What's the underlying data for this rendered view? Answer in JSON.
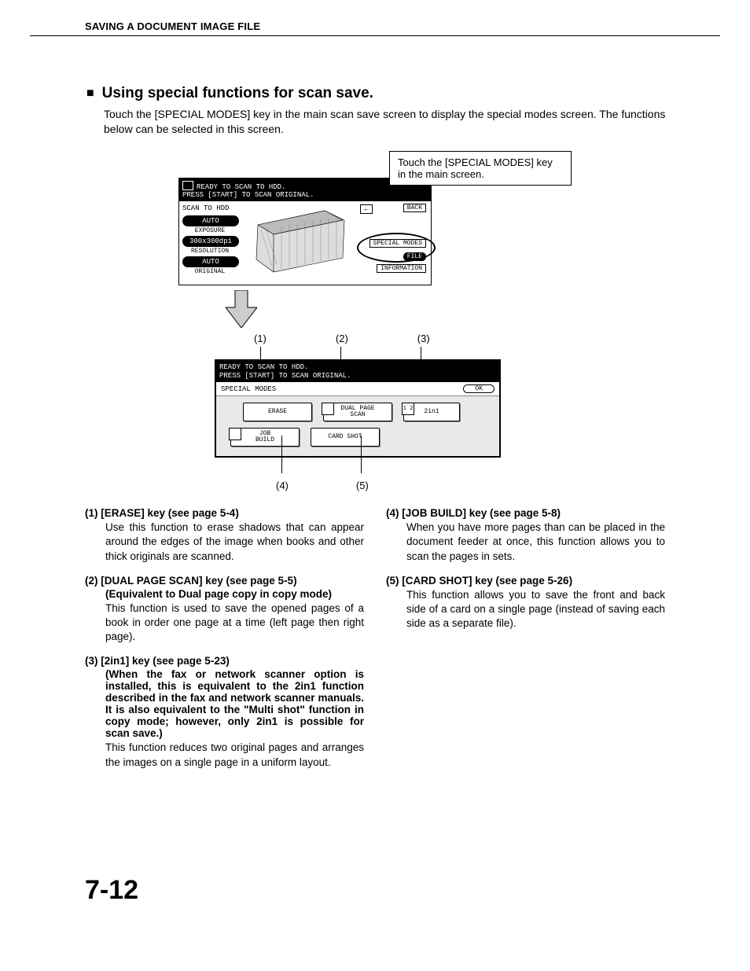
{
  "header": "SAVING A DOCUMENT IMAGE FILE",
  "section": {
    "title": "Using special functions for scan save.",
    "intro": "Touch the [SPECIAL MODES] key in the main scan save screen to display the special modes screen. The functions below can be selected in this screen."
  },
  "tip": "Touch the [SPECIAL MODES] key in the main screen.",
  "screen1": {
    "status_l1": "READY TO SCAN TO HDD.",
    "status_l2": " PRESS [START] TO SCAN ORIGINAL.",
    "title": "SCAN TO HDD",
    "p_auto": "AUTO",
    "p_exposure": "EXPOSURE",
    "p_res": "300x300dpi",
    "p_resolution": "RESOLUTION",
    "p_auto2": "AUTO",
    "p_original": "ORIGINAL",
    "back": "BACK",
    "special": "SPECIAL MODES",
    "file": "FILE",
    "info": "INFORMATION"
  },
  "guide_top": {
    "c1": "(1)",
    "c2": "(2)",
    "c3": "(3)"
  },
  "screen2": {
    "status_l1": "READY TO SCAN TO HDD.",
    "status_l2": " PRESS [START] TO SCAN ORIGINAL.",
    "subtitle": "SPECIAL MODES",
    "ok": "OK",
    "b_erase": "ERASE",
    "b_dual_l1": "DUAL PAGE",
    "b_dual_l2": "SCAN",
    "b_2in1": "2in1",
    "b_job_l1": "JOB",
    "b_job_l2": "BUILD",
    "b_card": "CARD SHOT",
    "ico_12": "1 2"
  },
  "guide_bot": {
    "c4": "(4)",
    "c5": "(5)"
  },
  "desc": {
    "i1h": "(1) [ERASE] key (see page 5-4)",
    "i1b": "Use this function to erase shadows that can appear around the edges of the image when books and other thick originals are scanned.",
    "i2h": "(2) [DUAL PAGE SCAN] key (see page 5-5)",
    "i2s": "(Equivalent to Dual page copy in copy mode)",
    "i2b": "This function is used to save the opened pages of a book in order one page at a time (left page then right page).",
    "i3h": "(3) [2in1] key (see page 5-23)",
    "i3s": "(When the fax or network scanner option is installed, this is equivalent to the 2in1 function described in the fax and network scanner manuals. It is also equivalent to the \"Multi shot\" function in copy mode; however, only 2in1 is possible for scan save.)",
    "i3b": "This function reduces two original pages and arranges the images on a single page in a uniform layout.",
    "i4h": "(4) [JOB BUILD] key (see page 5-8)",
    "i4b": "When you have more pages than can be placed in the document feeder at once, this function allows you to scan the pages in sets.",
    "i5h": "(5) [CARD SHOT] key (see page 5-26)",
    "i5b": "This function allows you to save the front and back side of a card on a single page (instead of saving each side as a separate file)."
  },
  "pagenum": "7-12"
}
